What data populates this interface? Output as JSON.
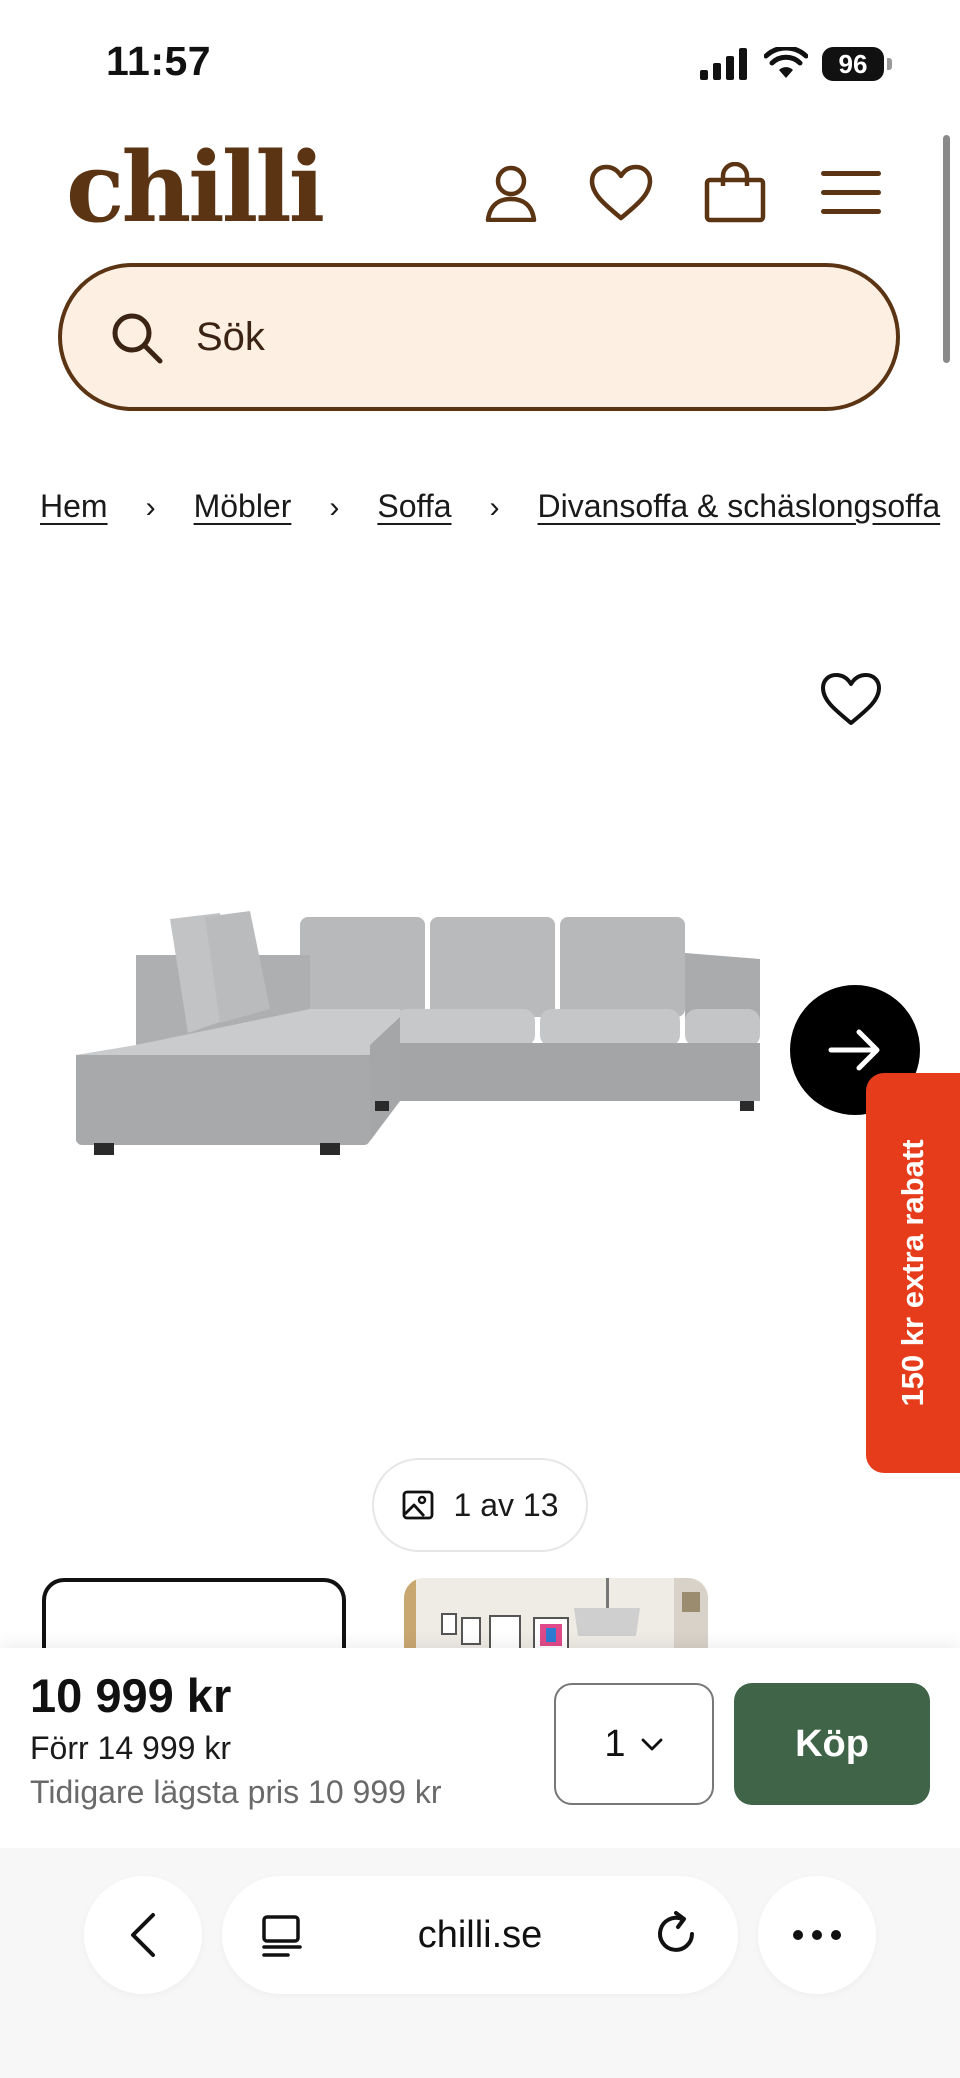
{
  "status_bar": {
    "time": "11:57",
    "battery": "96"
  },
  "header": {
    "logo": "chilli",
    "icons": [
      "user-icon",
      "heart-icon",
      "shopping-bag-icon",
      "menu-icon"
    ],
    "brand_color": "#5b3414"
  },
  "search": {
    "placeholder": "Sök",
    "background": "#fdf0e3"
  },
  "breadcrumb": [
    "Hem",
    "Möbler",
    "Soffa",
    "Divansoffa & schäslongsoffa"
  ],
  "gallery": {
    "counter": "1 av 13",
    "current_image": 1,
    "total_images": 13
  },
  "promo": {
    "label": "150 kr extra rabatt",
    "color": "#e63c1b"
  },
  "product": {
    "price": "10 999 kr",
    "previous_price": "Förr 14 999 kr",
    "lowest_price": "Tidigare lägsta pris 10 999 kr",
    "quantity": "1",
    "buy_label": "Köp",
    "buy_color": "#3f6447"
  },
  "browser": {
    "url": "chilli.se"
  }
}
